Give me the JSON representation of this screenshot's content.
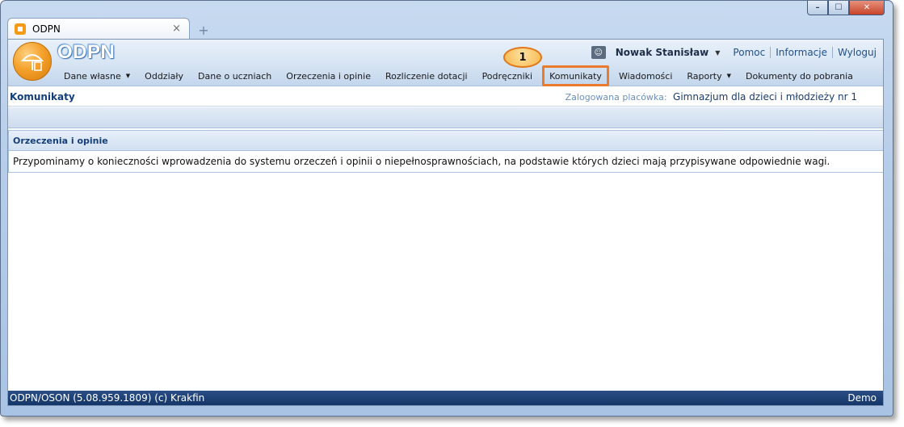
{
  "tab": {
    "title": "ODPN",
    "close_glyph": "×",
    "new_tab_glyph": "+"
  },
  "window_controls": {
    "minimize": "–",
    "maximize": "☐",
    "close": "✕"
  },
  "app": {
    "name": "ODPN",
    "logo_icon": "umbrella-calculator-icon"
  },
  "user": {
    "name": "Nowak Stanisław",
    "links": [
      "Pomoc",
      "Informacje",
      "Wyloguj"
    ]
  },
  "menu": {
    "items": [
      {
        "label": "Dane własne",
        "has_dropdown": true
      },
      {
        "label": "Oddziały",
        "has_dropdown": false
      },
      {
        "label": "Dane o uczniach",
        "has_dropdown": false
      },
      {
        "label": "Orzeczenia i opinie",
        "has_dropdown": false
      },
      {
        "label": "Rozliczenie dotacji",
        "has_dropdown": false
      },
      {
        "label": "Podręczniki",
        "has_dropdown": false
      },
      {
        "label": "Komunikaty",
        "has_dropdown": false,
        "active": true
      },
      {
        "label": "Wiadomości",
        "has_dropdown": false
      },
      {
        "label": "Raporty",
        "has_dropdown": true
      },
      {
        "label": "Dokumenty do pobrania",
        "has_dropdown": false
      }
    ]
  },
  "callout": {
    "number": "1"
  },
  "page": {
    "title": "Komunikaty",
    "placowka_label": "Zalogowana placówka:",
    "placowka_value": "Gimnazjum dla dzieci i młodzieży nr 1"
  },
  "panel": {
    "header": "Orzeczenia i opinie",
    "message": "Przypominamy o konieczności wprowadzenia do systemu orzeczeń i opinii o niepełnosprawnościach, na podstawie których dzieci mają przypisywane odpowiednie wagi."
  },
  "status": {
    "left": "ODPN/OSON (5.08.959.1809) (c) Krakfin",
    "right": "Demo"
  },
  "colors": {
    "accent": "#ea7b2c",
    "statusbar": "#1c3f74",
    "title": "#123f7a"
  }
}
